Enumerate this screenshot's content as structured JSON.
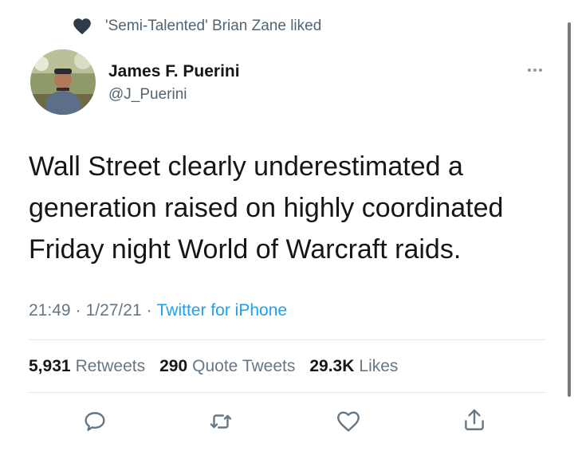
{
  "social_context": {
    "text": "'Semi-Talented' Brian Zane liked",
    "icon": "heart-filled-icon"
  },
  "author": {
    "name": "James F. Puerini",
    "handle": "@J_Puerini"
  },
  "tweet": {
    "text": "Wall Street clearly underestimated a\ngeneration raised on highly coordinated\nFriday night World of Warcraft raids.",
    "time": "21:49",
    "date": "1/27/21",
    "source": "Twitter for iPhone",
    "separator": "·"
  },
  "stats": [
    {
      "count": "5,931",
      "label": "Retweets"
    },
    {
      "count": "290",
      "label": "Quote Tweets"
    },
    {
      "count": "29.3K",
      "label": "Likes"
    }
  ],
  "actions": [
    "reply-icon",
    "retweet-icon",
    "like-icon",
    "share-icon"
  ],
  "colors": {
    "link": "#1da1f2",
    "secondary_text": "#657786",
    "divider": "#e1e8ed",
    "icon": "#657786"
  }
}
